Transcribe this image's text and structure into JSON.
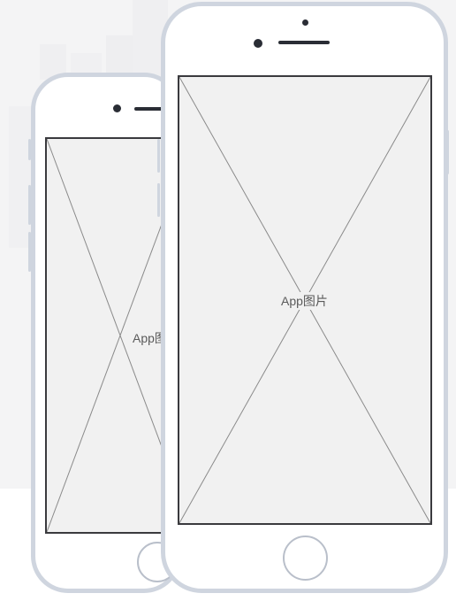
{
  "placeholders": {
    "back_phone_label": "App图片",
    "front_phone_label": "App图片"
  },
  "colors": {
    "phone_frame": "#cfd5df",
    "screen_fill": "#f1f1f1",
    "screen_border": "#3a3a3e",
    "page_background": "#f4f4f5"
  }
}
